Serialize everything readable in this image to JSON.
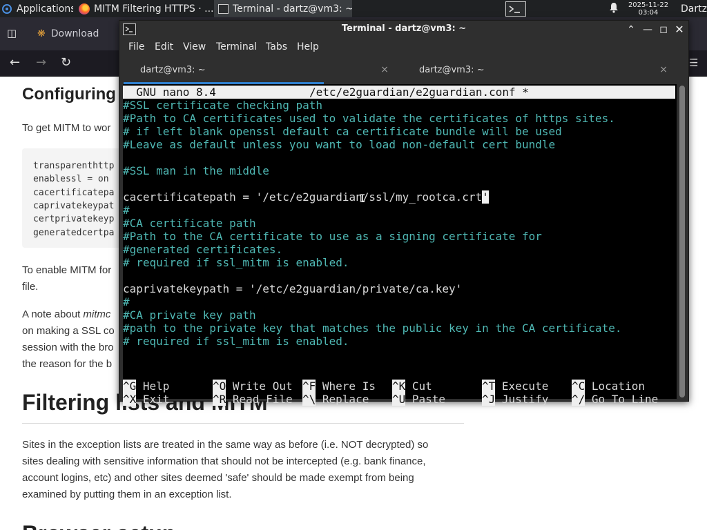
{
  "panel": {
    "apps_label": "Applications",
    "apps_suffix": "≡",
    "firefox_task": "MITM Filtering HTTPS · ...",
    "terminal_task": "Terminal - dartz@vm3: ~",
    "clock_date": "2025-11-22",
    "clock_time": "03:04",
    "user": "Dartz"
  },
  "browser": {
    "tab_label": "Download",
    "article": {
      "heading_configuring": "Configuring",
      "intro": "To get MITM to wor",
      "code_lines": [
        "transparenthttp",
        "enablessl = on",
        "cacertificatepa",
        "caprivatekeypat",
        "certprivatekeyp",
        "generatedcertpa"
      ],
      "enable_line1": "To enable MITM for",
      "enable_line2": "file.",
      "note_line1_prefix": "A note about ",
      "note_line1_em": "mitmc",
      "note_line2": "on making a SSL co",
      "note_line3": "session with the bro",
      "note_line4": "the reason for the b",
      "heading_filtering": "Filtering lists and MITM",
      "para_lines": [
        "Sites in the exception lists are treated in the same way as before (i.e. NOT decrypted) so",
        "sites dealing with sensitive information that should not be intercepted (e.g. bank finance,",
        "account logins, etc) and other sites deemed 'safe' should be made exempt from being",
        "examined by putting them in an exception list."
      ],
      "heading_browser": "Browser setup"
    }
  },
  "terminal": {
    "title": "Terminal - dartz@vm3: ~",
    "menu": [
      "File",
      "Edit",
      "View",
      "Terminal",
      "Tabs",
      "Help"
    ],
    "tabs": [
      {
        "label": "dartz@vm3: ~",
        "close": "×"
      },
      {
        "label": "dartz@vm3: ~",
        "close": "×"
      }
    ],
    "nano": {
      "header_app": "  GNU nano 8.4",
      "header_file": "/etc/e2guardian/e2guardian.conf *",
      "lines": [
        {
          "text": "#SSL certificate checking path",
          "kind": "comment"
        },
        {
          "text": "#Path to CA certificates used to validate the certificates of https sites.",
          "kind": "comment"
        },
        {
          "text": "# if left blank openssl default ca certificate bundle will be used",
          "kind": "comment"
        },
        {
          "text": "#Leave as default unless you want to load non-default cert bundle",
          "kind": "comment"
        },
        {
          "text": "",
          "kind": "plain"
        },
        {
          "text": "#SSL man in the middle",
          "kind": "comment"
        },
        {
          "text": "",
          "kind": "plain"
        },
        {
          "text": "cacertificatepath = '/etc/e2guardian/ssl/my_rootca.crt",
          "kind": "cursor",
          "cursor_char": "'"
        },
        {
          "text": "#",
          "kind": "comment"
        },
        {
          "text": "#CA certificate path",
          "kind": "comment"
        },
        {
          "text": "#Path to the CA certificate to use as a signing certificate for",
          "kind": "comment"
        },
        {
          "text": "#generated certificates.",
          "kind": "comment"
        },
        {
          "text": "# required if ssl_mitm is enabled.",
          "kind": "comment"
        },
        {
          "text": "",
          "kind": "plain"
        },
        {
          "text": "caprivatekeypath = '/etc/e2guardian/private/ca.key'",
          "kind": "plain"
        },
        {
          "text": "#",
          "kind": "comment"
        },
        {
          "text": "#CA private key path",
          "kind": "comment"
        },
        {
          "text": "#path to the private key that matches the public key in the CA certificate.",
          "kind": "comment"
        },
        {
          "text": "# required if ssl_mitm is enabled.",
          "kind": "comment"
        }
      ],
      "shortcuts_row1": [
        {
          "key": "^G",
          "label": " Help"
        },
        {
          "key": "^O",
          "label": " Write Out"
        },
        {
          "key": "^F",
          "label": " Where Is"
        },
        {
          "key": "^K",
          "label": " Cut"
        },
        {
          "key": "^T",
          "label": " Execute"
        },
        {
          "key": "^C",
          "label": " Location"
        }
      ],
      "shortcuts_row2": [
        {
          "key": "^X",
          "label": " Exit"
        },
        {
          "key": "^R",
          "label": " Read File"
        },
        {
          "key": "^\\",
          "label": " Replace"
        },
        {
          "key": "^U",
          "label": " Paste"
        },
        {
          "key": "^J",
          "label": " Justify"
        },
        {
          "key": "^/",
          "label": " Go To Line"
        }
      ]
    }
  }
}
